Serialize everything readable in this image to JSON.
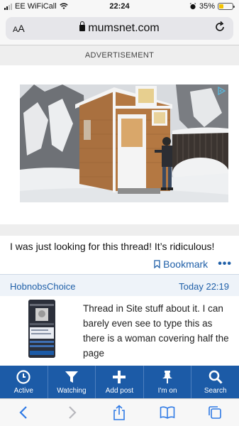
{
  "status_bar": {
    "carrier": "EE WiFiCall",
    "time": "22:24",
    "battery_percent": "35%",
    "battery_level": 0.35,
    "battery_color": "#f2c200"
  },
  "browser": {
    "text_size_label": "AA",
    "domain": "mumsnet.com"
  },
  "ad": {
    "label": "ADVERTISEMENT"
  },
  "post": {
    "text": "I was just looking for this thread! It’s ridiculous!",
    "bookmark_label": "Bookmark",
    "more_label": "•••"
  },
  "reply": {
    "author": "HobnobsChoice",
    "timestamp": "Today 22:19",
    "text": "Thread in Site stuff about it. I can barely even see to type this as there is a woman covering half the page"
  },
  "nav": {
    "items": [
      {
        "label": "Active",
        "icon": "clock-icon"
      },
      {
        "label": "Watching",
        "icon": "filter-icon"
      },
      {
        "label": "Add post",
        "icon": "plus-icon"
      },
      {
        "label": "I'm on",
        "icon": "pin-icon"
      },
      {
        "label": "Search",
        "icon": "search-icon"
      }
    ]
  },
  "colors": {
    "accent": "#1f5fa8",
    "nav_bar": "#1c5ba7"
  }
}
